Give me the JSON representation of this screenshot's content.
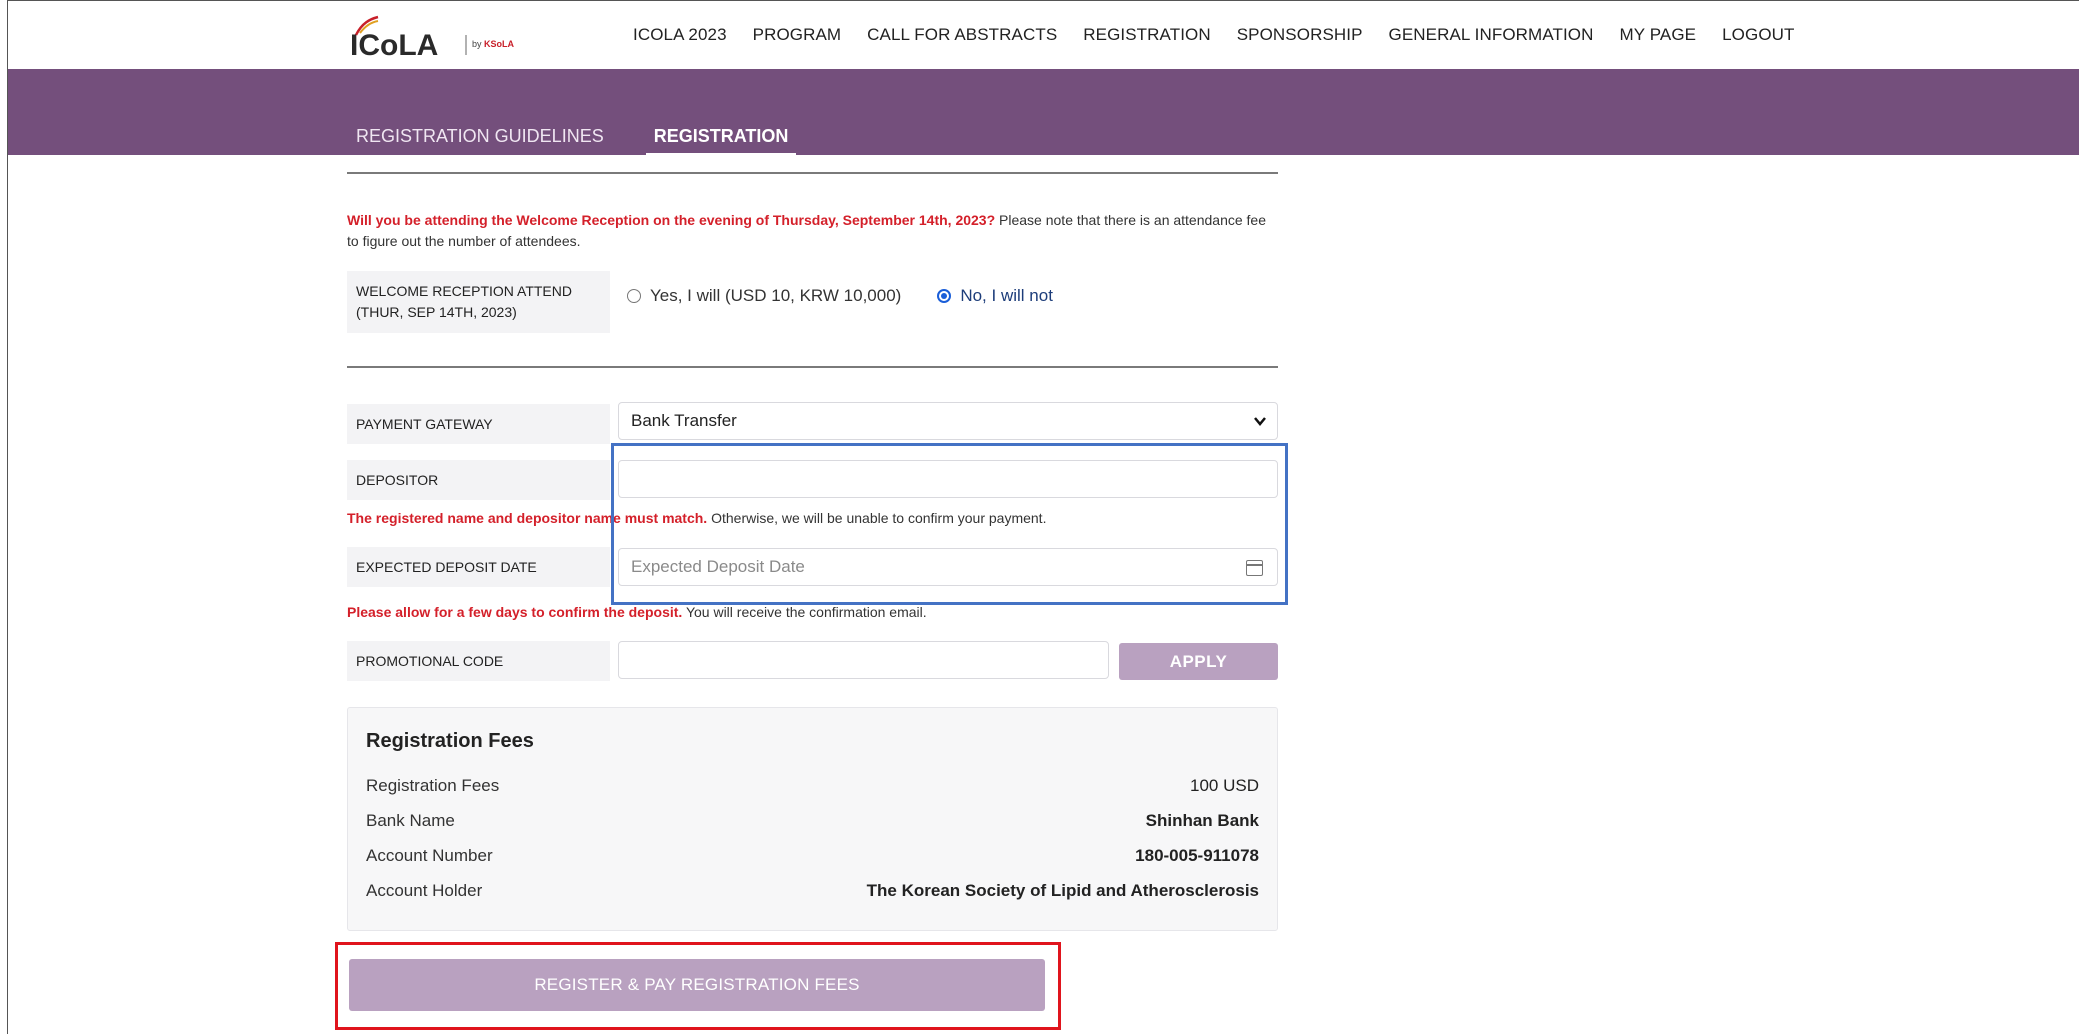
{
  "header": {
    "logo_text": "ICoLA",
    "logo_sub": "by KSoLA",
    "nav": [
      "ICOLA 2023",
      "PROGRAM",
      "CALL FOR ABSTRACTS",
      "REGISTRATION",
      "SPONSORSHIP",
      "GENERAL INFORMATION",
      "MY PAGE",
      "LOGOUT"
    ]
  },
  "tabs": [
    "REGISTRATION GUIDELINES",
    "REGISTRATION"
  ],
  "reception": {
    "notice_red": "Will you be attending the Welcome Reception on the evening of Thursday, September 14th, 2023?",
    "notice_rest": " Please note that there is an attendance fee to figure out the number of attendees.",
    "label_line1": "WELCOME RECEPTION ATTEND",
    "label_line2": "(THUR, SEP 14TH, 2023)",
    "option_yes": "Yes, I will (USD 10, KRW 10,000)",
    "option_no": "No, I will not"
  },
  "payment": {
    "gateway_label": "PAYMENT GATEWAY",
    "gateway_value": "Bank Transfer",
    "depositor_label": "DEPOSITOR",
    "depositor_value": "",
    "depositor_notice_red": "The registered name and depositor name must match.",
    "depositor_notice_rest": " Otherwise, we will be unable to confirm your payment.",
    "date_label": "EXPECTED DEPOSIT DATE",
    "date_placeholder": "Expected Deposit Date",
    "date_notice_red": "Please allow for a few days to confirm the deposit.",
    "date_notice_rest": " You will receive the confirmation email.",
    "promo_label": "PROMOTIONAL CODE",
    "promo_value": "",
    "apply_label": "APPLY"
  },
  "fees": {
    "title": "Registration Fees",
    "rows": [
      {
        "label": "Registration Fees",
        "value": "100 USD"
      },
      {
        "label": "Bank Name",
        "value": "Shinhan Bank"
      },
      {
        "label": "Account Number",
        "value": "180-005-911078"
      },
      {
        "label": "Account Holder",
        "value": "The Korean Society of Lipid and Atherosclerosis"
      }
    ]
  },
  "submit_label": "REGISTER & PAY REGISTRATION FEES",
  "colors": {
    "band": "#744f7c",
    "button": "#b9a1c0",
    "notice_red": "#d4202a",
    "highlight_blue": "#4472c4",
    "highlight_red": "#e0141d"
  }
}
